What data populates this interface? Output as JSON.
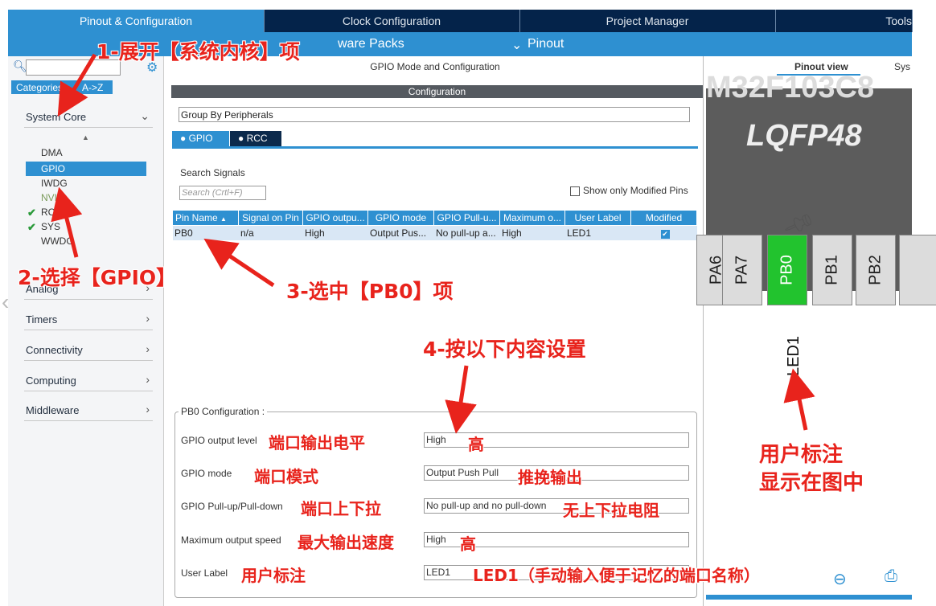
{
  "top_tabs": [
    "Pinout & Configuration",
    "Clock Configuration",
    "Project Manager",
    "Tools"
  ],
  "subbar": {
    "software_packs": "ware Packs",
    "pinout": "Pinout"
  },
  "left": {
    "search_placeholder": "",
    "tab_categories": "Categories",
    "tab_az": "A->Z",
    "categories": [
      "System Core",
      "Analog",
      "Timers",
      "Connectivity",
      "Computing",
      "Middleware"
    ],
    "system_core_items": [
      "DMA",
      "GPIO",
      "IWDG",
      "NVIC",
      "RCC",
      "SYS",
      "WWDG"
    ]
  },
  "mid": {
    "heading": "GPIO Mode and Configuration",
    "config_bar": "Configuration",
    "group_by": "Group By Peripherals",
    "tab_gpio": "GPIO",
    "tab_rcc": "RCC",
    "search_label": "Search Signals",
    "search_placeholder": "Search (Crtl+F)",
    "show_modified": "Show only Modified Pins",
    "table_headers": [
      "Pin Name",
      "Signal on Pin",
      "GPIO outpu...",
      "GPIO mode",
      "GPIO Pull-u...",
      "Maximum o...",
      "User Label",
      "Modified"
    ],
    "row": [
      "PB0",
      "n/a",
      "High",
      "Output Pus...",
      "No pull-up a...",
      "High",
      "LED1"
    ],
    "pb0": {
      "legend": "PB0 Configuration :",
      "labels": [
        "GPIO output level",
        "GPIO mode",
        "GPIO Pull-up/Pull-down",
        "Maximum output speed",
        "User Label"
      ],
      "values": [
        "High",
        "Output Push Pull",
        "No pull-up and no pull-down",
        "High",
        "LED1"
      ]
    }
  },
  "right": {
    "tab_pinout_view": "Pinout view",
    "tab_sys": "Sys",
    "chip_partial": "M32F103C8",
    "package": "LQFP48",
    "pins": [
      "PA6",
      "PA7",
      "PB0",
      "PB1",
      "PB2"
    ],
    "pin_label": "LED1"
  },
  "annotations": {
    "a1": "1-展开【系统内核】项",
    "a2": "2-选择【GPIO】",
    "a3": "3-选中【PB0】项",
    "a4": "4-按以下内容设置",
    "r1": "端口输出电平",
    "r1v": "高",
    "r2": "端口模式",
    "r2v": "推挽输出",
    "r3": "端口上下拉",
    "r3v": "无上下拉电阻",
    "r4": "最大输出速度",
    "r4v": "高",
    "r5": "用户标注",
    "r5v": "LED1（手动输入便于记忆的端口名称）",
    "right_note_1": "用户标注",
    "right_note_2": "显示在图中"
  },
  "colors": {
    "accent": "#2e90d1",
    "nav": "#04234a",
    "annotation": "#e8231c",
    "pin_active": "#22c32e"
  }
}
